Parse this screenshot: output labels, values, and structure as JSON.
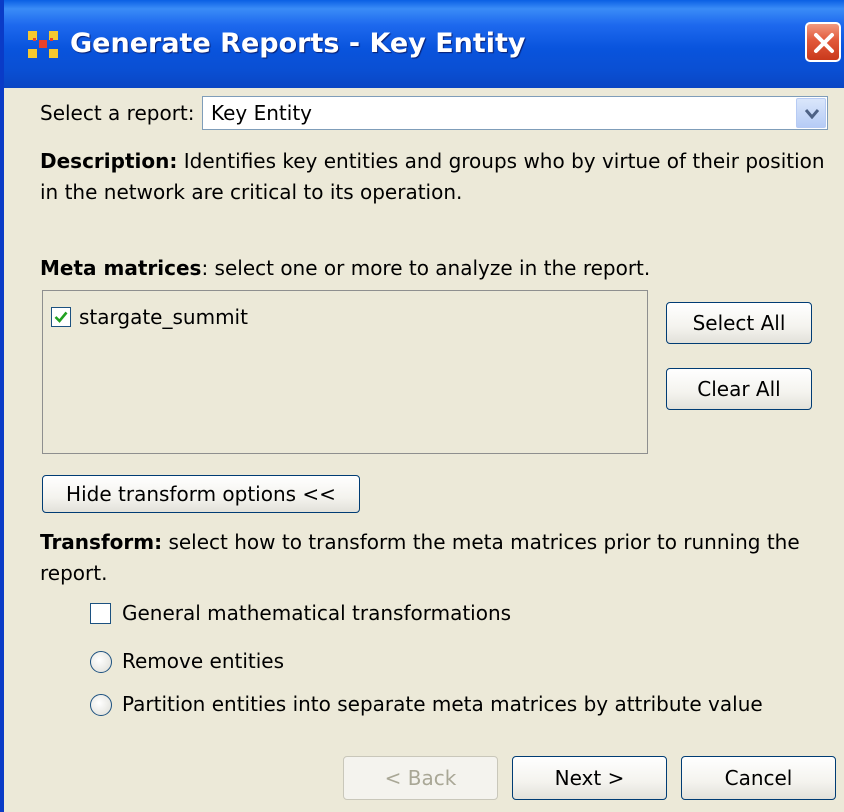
{
  "window": {
    "title": "Generate Reports - Key Entity",
    "icon": "network-nodes-icon",
    "close": "close-icon"
  },
  "report_select": {
    "label": "Select a report:",
    "value": "Key Entity"
  },
  "description": {
    "heading": "Description:",
    "text": "Identifies key entities and groups who by virtue of their position in the network are critical to its operation."
  },
  "meta_matrices": {
    "heading": "Meta matrices",
    "instruction": ": select one or more to analyze in the report.",
    "items": [
      {
        "label": "stargate_summit",
        "checked": true
      }
    ],
    "select_all": "Select All",
    "clear_all": "Clear All"
  },
  "transform_toggle": "Hide transform options <<",
  "transform": {
    "heading": "Transform:",
    "text": "select how to transform the meta matrices prior to running the report.",
    "options": [
      {
        "label": "General mathematical transformations",
        "type": "checkbox",
        "checked": false
      },
      {
        "label": "Remove entities",
        "type": "radio",
        "selected": false
      },
      {
        "label": "Partition entities into separate meta matrices by attribute value",
        "type": "radio",
        "selected": false
      }
    ]
  },
  "footer": {
    "back": "< Back",
    "next": "Next >",
    "cancel": "Cancel"
  },
  "colors": {
    "titlebar": "#0A4FD3",
    "window_bg": "#ECE9D8",
    "close_button": "#E2593A",
    "check_mark": "#21A121"
  }
}
